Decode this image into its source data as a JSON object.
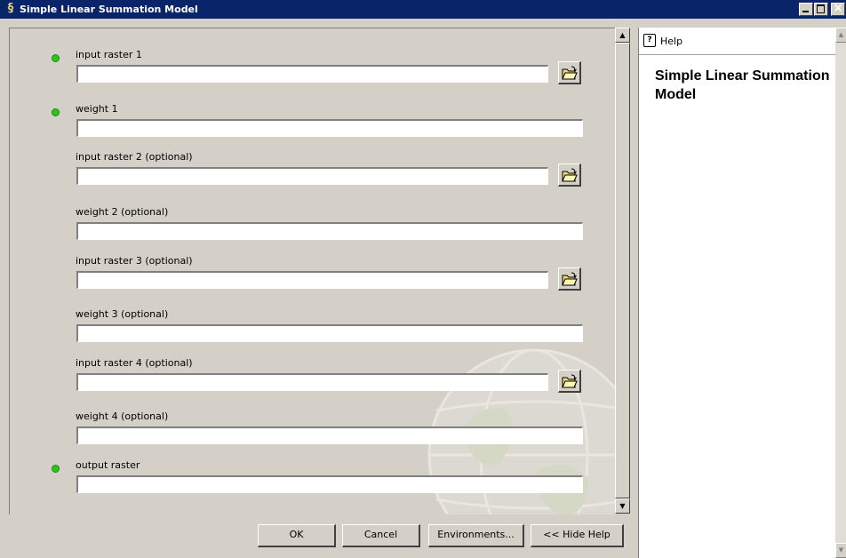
{
  "window": {
    "title": "Simple Linear Summation Model",
    "app_icon": "arctoolbox-model-icon",
    "controls": {
      "minimize": "_",
      "maximize": "□",
      "close": "×"
    }
  },
  "form": {
    "fields": [
      {
        "label": "input raster 1",
        "required": true,
        "type": "raster",
        "value": ""
      },
      {
        "label": "weight 1",
        "required": true,
        "type": "text",
        "value": ""
      },
      {
        "label": "input raster 2 (optional)",
        "required": false,
        "type": "raster",
        "value": ""
      },
      {
        "label": "weight 2 (optional)",
        "required": false,
        "type": "text",
        "value": ""
      },
      {
        "label": "input raster 3 (optional)",
        "required": false,
        "type": "raster",
        "value": ""
      },
      {
        "label": "weight 3 (optional)",
        "required": false,
        "type": "text",
        "value": ""
      },
      {
        "label": "input raster 4 (optional)",
        "required": false,
        "type": "raster",
        "value": ""
      },
      {
        "label": "weight 4 (optional)",
        "required": false,
        "type": "text",
        "value": ""
      },
      {
        "label": "output raster",
        "required": true,
        "type": "text",
        "value": ""
      }
    ],
    "browse_icon": "open-folder-icon",
    "required_indicator_color": "#2ec41a"
  },
  "buttons": {
    "ok": "OK",
    "cancel": "Cancel",
    "environments": "Environments...",
    "hide_help": "<< Hide Help"
  },
  "help": {
    "tab_label": "Help",
    "title": "Simple Linear Summation Model"
  },
  "colors": {
    "titlebar": "#0a246a",
    "dialog_face": "#d4d0c8"
  }
}
